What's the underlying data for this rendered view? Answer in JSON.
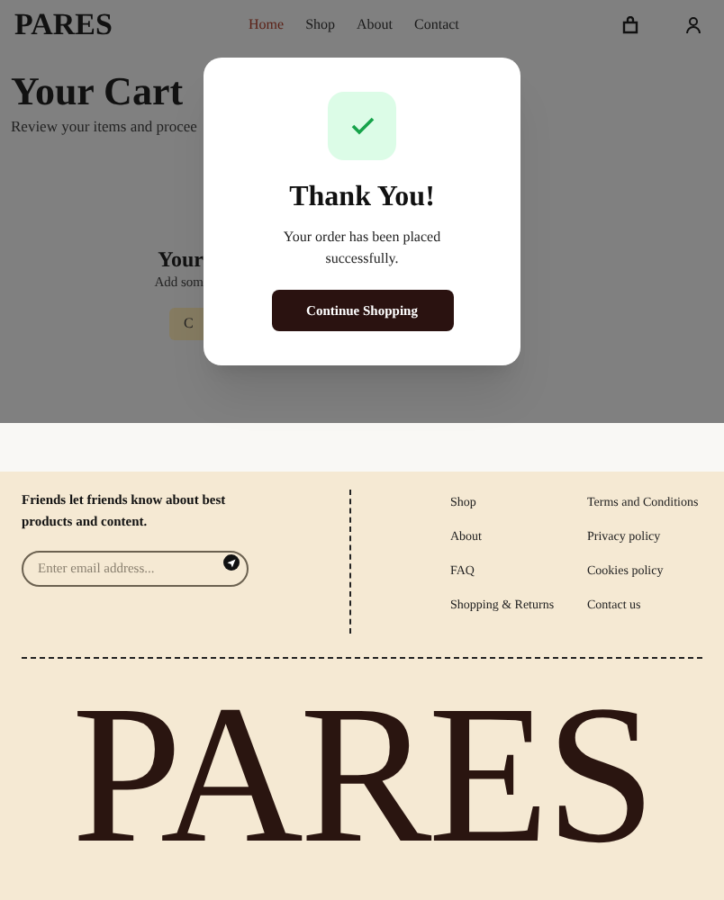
{
  "header": {
    "logo": "PARES",
    "nav": [
      {
        "label": "Home",
        "selected": true
      },
      {
        "label": "Shop",
        "selected": false
      },
      {
        "label": "About",
        "selected": false
      },
      {
        "label": "Contact",
        "selected": false
      }
    ]
  },
  "page": {
    "title": "Your Cart",
    "subtitle": "Review your items and procee",
    "empty_title": "Your",
    "empty_text": "Add som",
    "empty_button": "C"
  },
  "modal": {
    "title": "Thank You!",
    "message": "Your order has been placed successfully.",
    "button": "Continue Shopping"
  },
  "footer": {
    "tagline": "Friends let friends know about best products and content.",
    "email": {
      "placeholder": "Enter email address..."
    },
    "links_1": [
      "Shop",
      "About",
      "FAQ",
      "Shopping & Returns"
    ],
    "links_2": [
      "Terms and Conditions",
      "Privacy policy",
      "Cookies policy",
      "Contact us"
    ],
    "wordmark": "PARES"
  }
}
